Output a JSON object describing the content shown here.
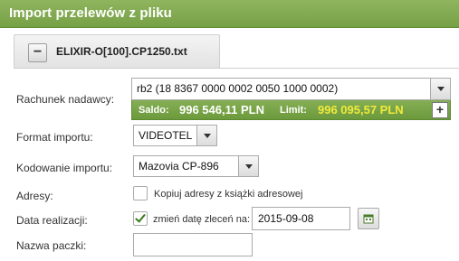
{
  "header": {
    "title": "Import przelewów z pliku"
  },
  "file_tab": {
    "file_name": "ELIXIR-O[100].CP1250.txt",
    "collapse_symbol": "−"
  },
  "form": {
    "sender_account": {
      "label": "Rachunek nadawcy:",
      "value": "rb2 (18 8367 0000 0002 0050 1000 0002)",
      "saldo_label": "Saldo:",
      "saldo_value": "996 546,11 PLN",
      "limit_label": "Limit:",
      "limit_value": "996 095,57 PLN",
      "add_symbol": "+"
    },
    "import_format": {
      "label": "Format importu:",
      "value": "VIDEOTEL"
    },
    "import_encoding": {
      "label": "Kodowanie importu:",
      "value": "Mazovia CP-896"
    },
    "addresses": {
      "label": "Adresy:",
      "checkbox_label": "Kopiuj adresy z książki adresowej",
      "checked": false
    },
    "execution_date": {
      "label": "Data realizacji:",
      "checkbox_label": "zmień datę zleceń na:",
      "checked": true,
      "value": "2015-09-08"
    },
    "batch_name": {
      "label": "Nazwa paczki:",
      "value": ""
    }
  },
  "colors": {
    "header": "#7fa84e",
    "limit_value": "#f1ea3a",
    "saldo_bar": "#78a447"
  },
  "icons": {
    "collapse": "minus-icon",
    "add": "plus-icon",
    "calendar": "calendar-icon",
    "dropdown": "chevron-down-icon"
  }
}
